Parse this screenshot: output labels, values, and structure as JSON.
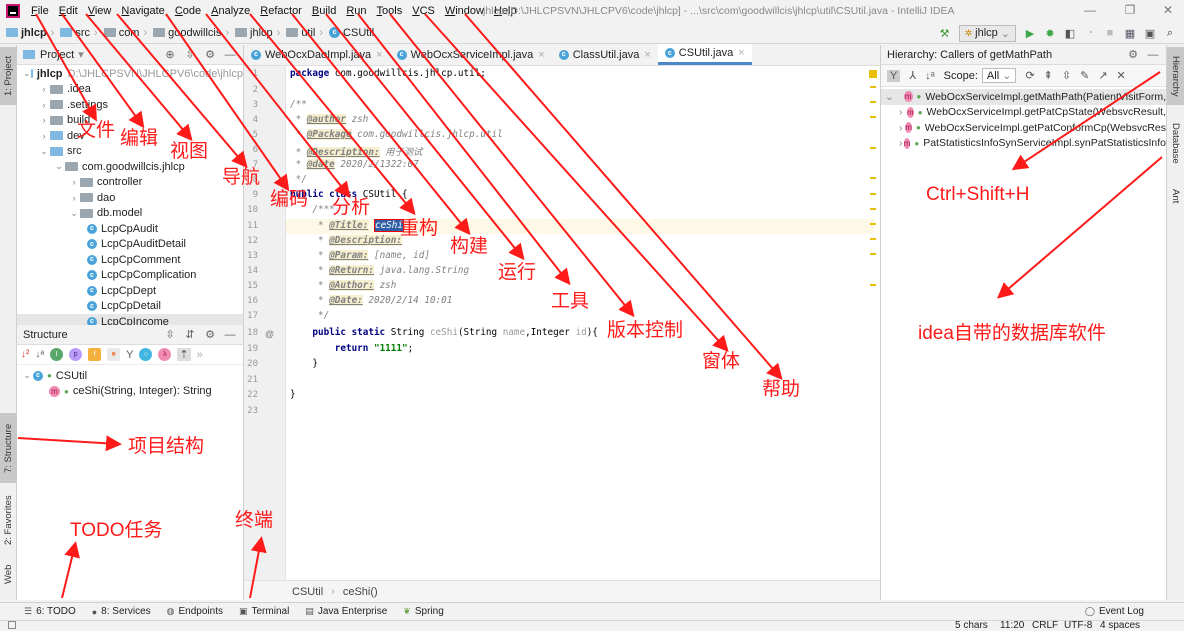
{
  "window": {
    "title": "jhlcp [D:\\JHLCPSVN\\JHLCPV6\\code\\jhlcp] - ...\\src\\com\\goodwillcis\\jhlcp\\util\\CSUtil.java - IntelliJ IDEA",
    "minimize": "—",
    "restore": "❐",
    "close": "✕"
  },
  "menu": [
    "File",
    "Edit",
    "View",
    "Navigate",
    "Code",
    "Analyze",
    "Refactor",
    "Build",
    "Run",
    "Tools",
    "VCS",
    "Window",
    "Help"
  ],
  "breadcrumb": [
    "jhlcp",
    "src",
    "com",
    "goodwillcis",
    "jhlcp",
    "util",
    "CSUtil"
  ],
  "run_config": {
    "name": "jhlcp"
  },
  "left_stripe": {
    "project": "1: Project",
    "structure": "7: Structure",
    "favorites": "2: Favorites",
    "web": "Web"
  },
  "project_panel": {
    "title": "Project",
    "tree": [
      {
        "label": "jhlcp",
        "path": "D:\\JHLCPSVN\\JHLCPV6\\code\\jhlcp",
        "depth": 0,
        "type": "root",
        "expanded": true
      },
      {
        "label": ".idea",
        "depth": 1,
        "type": "folder"
      },
      {
        "label": ".settings",
        "depth": 1,
        "type": "folder"
      },
      {
        "label": "build",
        "depth": 1,
        "type": "folder"
      },
      {
        "label": "dev",
        "depth": 1,
        "type": "folder-blue"
      },
      {
        "label": "src",
        "depth": 1,
        "type": "folder-blue",
        "expanded": true
      },
      {
        "label": "com.goodwillcis.jhlcp",
        "depth": 2,
        "type": "package",
        "expanded": true
      },
      {
        "label": "controller",
        "depth": 3,
        "type": "package"
      },
      {
        "label": "dao",
        "depth": 3,
        "type": "package"
      },
      {
        "label": "db.model",
        "depth": 3,
        "type": "package",
        "expanded": true
      },
      {
        "label": "LcpCpAudit",
        "depth": 4,
        "type": "class"
      },
      {
        "label": "LcpCpAuditDetail",
        "depth": 4,
        "type": "class"
      },
      {
        "label": "LcpCpComment",
        "depth": 4,
        "type": "class"
      },
      {
        "label": "LcpCpComplication",
        "depth": 4,
        "type": "class"
      },
      {
        "label": "LcpCpDept",
        "depth": 4,
        "type": "class"
      },
      {
        "label": "LcpCpDetail",
        "depth": 4,
        "type": "class"
      },
      {
        "label": "LcpCpIncome",
        "depth": 4,
        "type": "class"
      }
    ]
  },
  "structure_panel": {
    "title": "Structure",
    "class_name": "CSUtil",
    "method": "ceShi(String, Integer): String"
  },
  "editor": {
    "tabs": [
      {
        "label": "WebOcxDaoImpl.java",
        "active": false
      },
      {
        "label": "WebOcxServiceImpl.java",
        "active": false
      },
      {
        "label": "ClassUtil.java",
        "active": false
      },
      {
        "label": "CSUtil.java",
        "active": true
      }
    ],
    "line_numbers": [
      "1",
      "2",
      "3",
      "4",
      "5",
      "6",
      "7",
      "8",
      "9",
      "10",
      "11",
      "12",
      "13",
      "14",
      "15",
      "16",
      "17",
      "18",
      "19",
      "20",
      "21",
      "22",
      "23"
    ],
    "code": {
      "l1_kw": "package",
      "l1_rest": " com.goodwillcis.jhlcp.util;",
      "l3": "/**",
      "l4_tag": "@author",
      "l4_rest": " zsh",
      "l5_tag": "@Package",
      "l5_rest": " com.goodwillcis.jhlcp.util",
      "l6_tag": "@Description:",
      "l6_rest": " 用于测试",
      "l7_tag": "@date",
      "l7_rest": " 2020/2/1322:07",
      "l8": " */",
      "l9_kw": "public class",
      "l9_rest": " CSUtil {",
      "l10": "    /***",
      "l11_tag": "@Title:",
      "l11_sel": "ceShi",
      "l12_tag": "@Description:",
      "l13_tag": "@Param:",
      "l13_rest": " [name, id]",
      "l14_tag": "@Return:",
      "l14_rest": " java.lang.String",
      "l15_tag": "@Author:",
      "l15_rest": " zsh",
      "l16_tag": "@Date:",
      "l16_rest": " 2020/2/14 10:01",
      "l17": "     */",
      "l18_kw": "public static",
      "l18_type": " String ",
      "l18_name": "ceShi",
      "l18_p1": "(String ",
      "l18_pn": "name",
      "l18_p2": ",Integer ",
      "l18_pi": "id",
      "l18_end": "){",
      "l19_kw": "return",
      "l19_str": "\"1111\"",
      "l19_end": ";",
      "l20": "    }",
      "l22": "}"
    },
    "gutter_at": "@",
    "breadcrumb": [
      "CSUtil",
      "ceShi()"
    ]
  },
  "hierarchy_panel": {
    "title": "Hierarchy:  Callers of getMathPath",
    "scope_label": "Scope:",
    "scope_value": "All",
    "items": [
      {
        "label": "WebOcxServiceImpl.getMathPath(PatientVisitForm,",
        "root": true
      },
      {
        "label": "WebOcxServiceImpl.getPatCpState(WebsvcResult,",
        "root": false
      },
      {
        "label": "WebOcxServiceImpl.getPatConformCp(WebsvcRes",
        "root": false
      },
      {
        "label": "PatStatisticsInfoSynServiceImpl.synPatStatisticsInfo",
        "root": false
      }
    ]
  },
  "right_stripe": {
    "hierarchy": "Hierarchy",
    "database": "Database",
    "ant": "Ant"
  },
  "bottom_tools": [
    {
      "label": "6: TODO",
      "icon": "list-icon"
    },
    {
      "label": "8: Services",
      "icon": "services-icon"
    },
    {
      "label": "Endpoints",
      "icon": "globe-icon"
    },
    {
      "label": "Terminal",
      "icon": "terminal-icon"
    },
    {
      "label": "Java Enterprise",
      "icon": "java-ee-icon"
    },
    {
      "label": "Spring",
      "icon": "spring-icon"
    }
  ],
  "event_log": "Event Log",
  "status": {
    "selection": "5 chars",
    "position": "11:20",
    "line_sep": "CRLF",
    "encoding": "UTF-8",
    "indent": "4 spaces"
  },
  "annotations": {
    "file": "文件",
    "edit": "编辑",
    "view": "视图",
    "navigate": "导航",
    "code": "编码",
    "analyze": "分析",
    "refactor": "重构",
    "build": "构建",
    "run": "运行",
    "tools": "工具",
    "vcs": "版本控制",
    "window": "窗体",
    "help": "帮助",
    "shortcut": "Ctrl+Shift+H",
    "database": "idea自带的数据库软件",
    "structure": "项目结构",
    "todo": "TODO任务",
    "terminal": "终端"
  },
  "colors": {
    "annotation": "#ff1a1a",
    "active_tab": "#4a88c7",
    "selection": "#2f5fa7",
    "keyword": "#000080",
    "string": "#008000"
  }
}
